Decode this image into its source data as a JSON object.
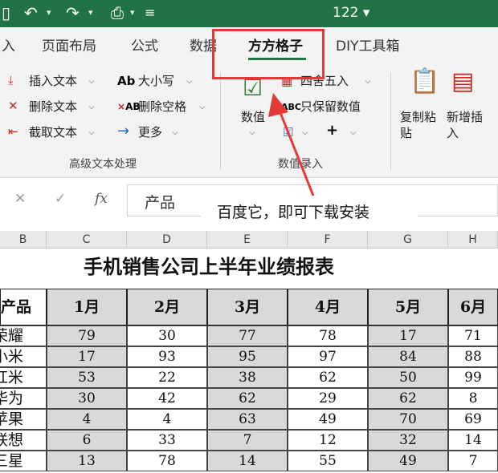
{
  "titlebar": {
    "doc_title": "122 ▾",
    "qa_icons": [
      "save-icon",
      "undo-icon",
      "redo-icon",
      "touch-mode-icon",
      "customize-icon"
    ]
  },
  "tabs": [
    {
      "label": "入",
      "active": false
    },
    {
      "label": "页面布局",
      "active": false
    },
    {
      "label": "公式",
      "active": false
    },
    {
      "label": "数据",
      "active": false
    },
    {
      "label": "方方格子",
      "active": true
    },
    {
      "label": "DIY工具箱",
      "active": false
    }
  ],
  "ribbon": {
    "text_group": {
      "items": [
        "插入文本",
        "删除文本",
        "截取文本",
        "大小写",
        "删除空格",
        "更多"
      ],
      "label": "高级文本处理"
    },
    "entry_group": {
      "numbers_button": "数值",
      "round_button": "四舍五入",
      "keep_numbers_button": "只保留数值",
      "label": "数值录入"
    },
    "right_group": {
      "copy_paste_button": "复制粘贴",
      "new_insert_button": "新增插入"
    }
  },
  "formula_bar": {
    "value": "产品",
    "fx": "fx",
    "callout": "百度它，即可下载安装"
  },
  "sheet": {
    "columns": [
      "B",
      "C",
      "D",
      "E",
      "F",
      "G",
      "H"
    ],
    "title": "手机销售公司上半年业绩报表",
    "header": [
      "产品",
      "1月",
      "2月",
      "3月",
      "4月",
      "5月",
      "6月"
    ],
    "rows": [
      {
        "name": "荣耀",
        "values": [
          "79",
          "30",
          "77",
          "78",
          "17",
          "71"
        ]
      },
      {
        "name": "小米",
        "values": [
          "17",
          "93",
          "95",
          "97",
          "84",
          "88"
        ]
      },
      {
        "name": "红米",
        "values": [
          "53",
          "22",
          "38",
          "62",
          "50",
          "99"
        ]
      },
      {
        "name": "华为",
        "values": [
          "30",
          "42",
          "62",
          "29",
          "62",
          "8"
        ]
      },
      {
        "name": "苹果",
        "values": [
          "4",
          "4",
          "63",
          "49",
          "70",
          "69"
        ]
      },
      {
        "name": "联想",
        "values": [
          "6",
          "33",
          "7",
          "12",
          "32",
          "14"
        ]
      },
      {
        "name": "三星",
        "values": [
          "13",
          "78",
          "14",
          "55",
          "49",
          "7"
        ]
      }
    ]
  },
  "colors": {
    "excel_green": "#217346",
    "highlight_red": "#e53935",
    "cell_gray": "#d9d9d9"
  }
}
